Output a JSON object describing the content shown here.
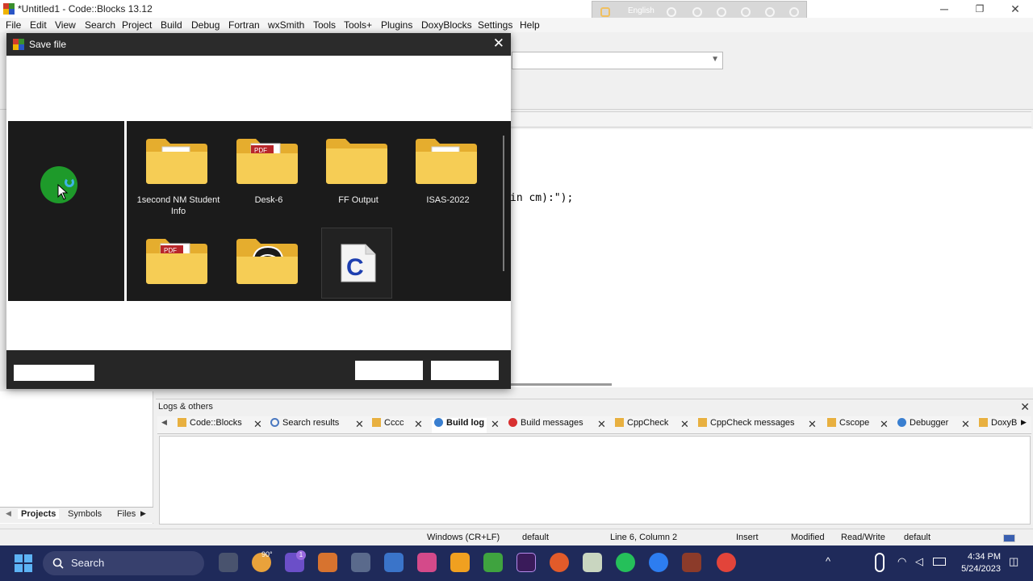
{
  "window": {
    "title": "*Untitled1 - Code::Blocks 13.12",
    "minimize": "─",
    "restore": "❐",
    "close": "✕"
  },
  "language_bar": {
    "label": "English"
  },
  "menu": [
    "File",
    "Edit",
    "View",
    "Search",
    "Project",
    "Build",
    "Debug",
    "Fortran",
    "wxSmith",
    "Tools",
    "Tools+",
    "Plugins",
    "DoxyBlocks",
    "Settings",
    "Help"
  ],
  "editor": {
    "code_fragment": "in cm):\");"
  },
  "dialog": {
    "title": "Save file",
    "close": "✕",
    "folders": [
      {
        "name": "1second NM Student Info",
        "kind": "docs-folder"
      },
      {
        "name": "Desk-6",
        "kind": "pdf-folder"
      },
      {
        "name": "FF Output",
        "kind": "plain-folder"
      },
      {
        "name": "ISAS-2022",
        "kind": "docs-folder"
      },
      {
        "name": "",
        "kind": "pdf-folder"
      },
      {
        "name": "",
        "kind": "media-folder"
      },
      {
        "name": "",
        "kind": "c-source-file"
      }
    ]
  },
  "management": {
    "tabs": [
      "Projects",
      "Symbols",
      "Files"
    ]
  },
  "logs": {
    "title": "Logs & others",
    "tabs": [
      "Code::Blocks",
      "Search results",
      "Cccc",
      "Build log",
      "Build messages",
      "CppCheck",
      "CppCheck messages",
      "Cscope",
      "Debugger",
      "DoxyB"
    ]
  },
  "statusbar": {
    "line_endings": "Windows (CR+LF)",
    "encoding": "default",
    "position": "Line 6, Column 2",
    "mode": "Insert",
    "modified": "Modified",
    "access": "Read/Write",
    "profile": "default"
  },
  "taskbar": {
    "search": "Search",
    "weather": "90°",
    "notification_badge": "1",
    "time": "4:34 PM",
    "date": "5/24/2023"
  },
  "colors": {
    "taskbar": "#1f2a5a",
    "folder": "#f3c64d",
    "dialog_dark": "#1b1b1b"
  }
}
